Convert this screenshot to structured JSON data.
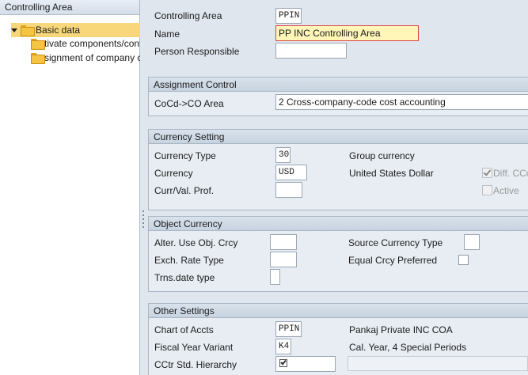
{
  "tree": {
    "header": "Controlling Area",
    "items": [
      {
        "label": "Basic data"
      },
      {
        "label": "Activate components/control indicators"
      },
      {
        "label": "Assignment of company codes"
      }
    ]
  },
  "header": {
    "controlling_area": {
      "label": "Controlling Area",
      "value": "PPIN"
    },
    "name": {
      "label": "Name",
      "value": "PP INC Controlling Area"
    },
    "person_responsible": {
      "label": "Person Responsible",
      "value": ""
    }
  },
  "assignment_control": {
    "title": "Assignment Control",
    "coco_label": "CoCd->CO Area",
    "coco_value": "2 Cross-company-code cost accounting"
  },
  "currency_setting": {
    "title": "Currency Setting",
    "currency_type_label": "Currency Type",
    "currency_type_value": "30",
    "currency_type_desc": "Group currency",
    "currency_label": "Currency",
    "currency_value": "USD",
    "currency_desc": "United States Dollar",
    "curr_val_prof_label": "Curr/Val. Prof.",
    "curr_val_prof_value": "",
    "diff_cc_label": "Diff. CCo",
    "diff_cc_checked": true,
    "active_label": "Active",
    "active_checked": false
  },
  "object_currency": {
    "title": "Object Currency",
    "alter_use_label": "Alter. Use Obj. Crcy",
    "exch_rate_label": "Exch. Rate Type",
    "trns_date_label": "Trns.date type",
    "source_currency_label": "Source Currency Type",
    "equal_crcy_label": "Equal Crcy Preferred"
  },
  "other_settings": {
    "title": "Other Settings",
    "chart_label": "Chart of Accts",
    "chart_value": "PPIN",
    "chart_desc": "Pankaj Private INC COA",
    "fiscal_label": "Fiscal Year Variant",
    "fiscal_value": "K4",
    "fiscal_desc": "Cal. Year, 4 Special Periods",
    "cctr_label": "CCtr Std. Hierarchy"
  },
  "colors": {
    "selected_tree_item": "#f7d77a",
    "focused_field": "#fff6b8",
    "focus_border": "#dd4444"
  }
}
